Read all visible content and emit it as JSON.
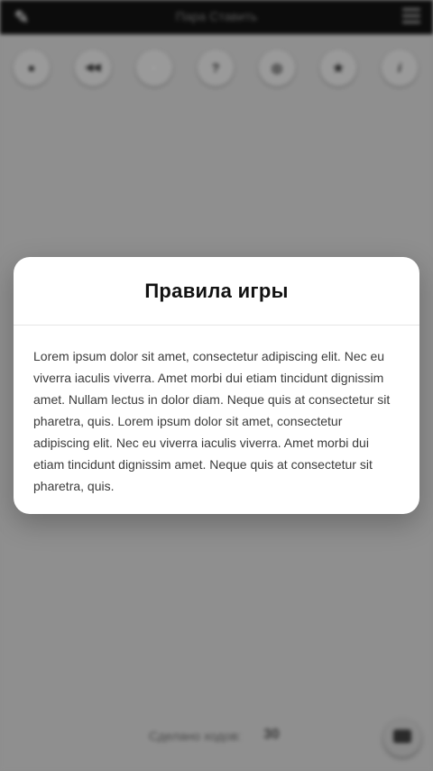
{
  "header": {
    "title": "Пара Ставить"
  },
  "toolbar": {
    "items": [
      {
        "icon": "record-icon",
        "glyph": "●"
      },
      {
        "icon": "playback-icon",
        "glyph": "◀◀"
      },
      {
        "icon": "spark-icon",
        "glyph": "·"
      },
      {
        "icon": "question-icon",
        "glyph": "?"
      },
      {
        "icon": "globe-icon",
        "glyph": "◎"
      },
      {
        "icon": "star-icon",
        "glyph": "★"
      },
      {
        "icon": "info-icon",
        "glyph": "i"
      }
    ]
  },
  "footer": {
    "label": "Сделано ходов:",
    "value": "30"
  },
  "modal": {
    "title": "Правила игры",
    "body": "Lorem ipsum dolor sit amet, consectetur adipiscing elit. Nec eu viverra iaculis viverra. Amet morbi dui etiam tincidunt dignissim amet. Nullam lectus in dolor diam. Neque quis at consectetur sit pharetra, quis. Lorem ipsum dolor sit amet, consectetur adipiscing elit. Nec eu viverra iaculis viverra. Amet morbi dui etiam tincidunt dignissim amet. Neque quis at consectetur sit pharetra, quis."
  }
}
